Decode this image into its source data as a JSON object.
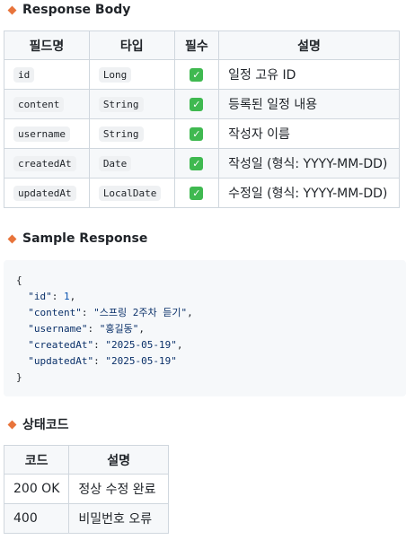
{
  "response_body": {
    "title": "Response Body",
    "headers": [
      "필드명",
      "타입",
      "필수",
      "설명"
    ],
    "rows": [
      {
        "field": "id",
        "type": "Long",
        "required": "✓",
        "desc": "일정 고유 ID"
      },
      {
        "field": "content",
        "type": "String",
        "required": "✓",
        "desc": "등록된 일정 내용"
      },
      {
        "field": "username",
        "type": "String",
        "required": "✓",
        "desc": "작성자 이름"
      },
      {
        "field": "createdAt",
        "type": "Date",
        "required": "✓",
        "desc": "작성일 (형식: YYYY-MM-DD)"
      },
      {
        "field": "updatedAt",
        "type": "LocalDate",
        "required": "✓",
        "desc": "수정일 (형식: YYYY-MM-DD)"
      }
    ]
  },
  "sample_response": {
    "title": "Sample Response",
    "open_brace": "{",
    "close_brace": "}",
    "lines": [
      {
        "key": "\"id\"",
        "sep": ": ",
        "value": "1",
        "value_type": "num",
        "trail": ","
      },
      {
        "key": "\"content\"",
        "sep": ": ",
        "value": "\"스프링 2주차 듣기\"",
        "value_type": "str",
        "trail": ","
      },
      {
        "key": "\"username\"",
        "sep": ": ",
        "value": "\"홍길동\"",
        "value_type": "str",
        "trail": ","
      },
      {
        "key": "\"createdAt\"",
        "sep": ": ",
        "value": "\"2025-05-19\"",
        "value_type": "str",
        "trail": ","
      },
      {
        "key": "\"updatedAt\"",
        "sep": ": ",
        "value": "\"2025-05-19\"",
        "value_type": "str",
        "trail": ""
      }
    ]
  },
  "status_codes": {
    "title": "상태코드",
    "headers": [
      "코드",
      "설명"
    ],
    "rows": [
      {
        "code": "200 OK",
        "desc": "정상 수정 완료"
      },
      {
        "code": "400",
        "desc": "비밀번호 오류"
      }
    ]
  },
  "colors": {
    "bullet": "#e8743b",
    "check": "#3fb950",
    "header_bg": "#f6f8fa",
    "border": "#d0d7de"
  }
}
